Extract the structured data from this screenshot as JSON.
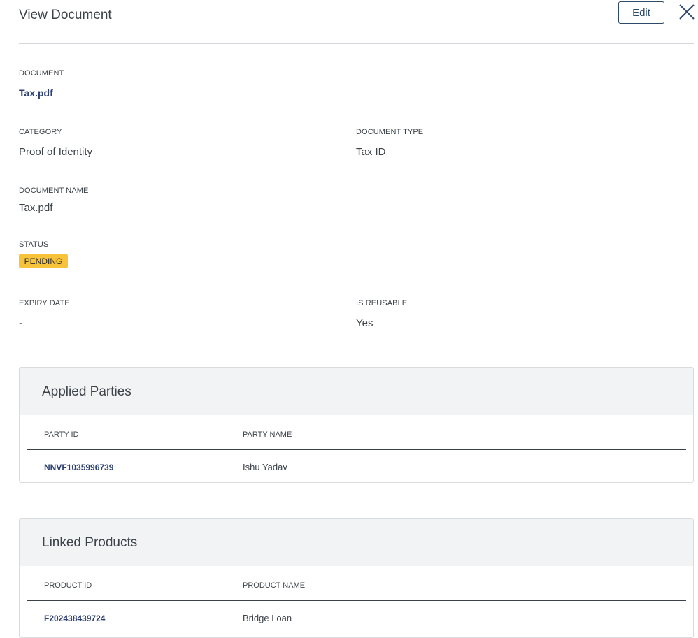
{
  "header": {
    "title": "View Document",
    "edit_label": "Edit",
    "close_icon": "close-icon"
  },
  "fields": {
    "document": {
      "label": "DOCUMENT",
      "value": "Tax.pdf"
    },
    "category": {
      "label": "CATEGORY",
      "value": "Proof of Identity"
    },
    "document_type": {
      "label": "DOCUMENT TYPE",
      "value": "Tax ID"
    },
    "document_name": {
      "label": "DOCUMENT NAME",
      "value": "Tax.pdf"
    },
    "status": {
      "label": "STATUS",
      "value": "PENDING",
      "color": "#f7c33b"
    },
    "expiry_date": {
      "label": "EXPIRY DATE",
      "value": "-"
    },
    "is_reusable": {
      "label": "IS REUSABLE",
      "value": "Yes"
    }
  },
  "applied_parties": {
    "title": "Applied Parties",
    "columns": [
      "PARTY ID",
      "PARTY NAME"
    ],
    "rows": [
      {
        "id": "NNVF1035996739",
        "name": "Ishu Yadav"
      }
    ]
  },
  "linked_products": {
    "title": "Linked Products",
    "columns": [
      "PRODUCT ID",
      "PRODUCT NAME"
    ],
    "rows": [
      {
        "id": "F202438439724",
        "name": "Bridge Loan"
      }
    ]
  },
  "colors": {
    "link": "#2b3f73",
    "panel_header_bg": "#f1f3f5",
    "status_badge": "#f7c33b"
  }
}
